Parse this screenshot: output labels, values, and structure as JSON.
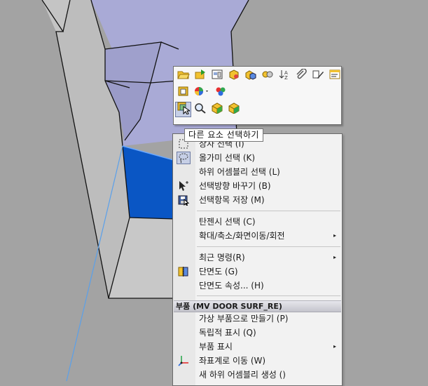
{
  "tooltip": "다른 요소 선택하기",
  "toolbar": {
    "row1": [
      "open-folder-icon",
      "rebuild-icon",
      "drawing-view-icon",
      "part-icon",
      "assembly-icon",
      "mate-icon",
      "sort-icon",
      "paperclip-icon",
      "edit-sketch-icon",
      "properties-icon"
    ],
    "row2": [
      "component-properties-icon",
      "appearance-icon",
      "color-wheel-icon"
    ],
    "row3": [
      "select-other-icon",
      "zoom-to-selection-icon",
      "hide-component-icon",
      "show-component-icon"
    ]
  },
  "menu": {
    "items_top": [
      {
        "label": "상자 선택 (I)",
        "icon": "box-select-icon",
        "active": false
      },
      {
        "label": "올가미 선택 (K)",
        "icon": "lasso-select-icon",
        "active": true
      },
      {
        "label": "하위 어셈블리 선택 (L)",
        "icon": null,
        "active": false
      },
      {
        "label": "선택방향 바꾸기 (B)",
        "icon": "cursor-arrow-icon",
        "active": false
      },
      {
        "label": "선택항목 저장 (M)",
        "icon": "save-selection-icon",
        "active": false
      }
    ],
    "items_mid": [
      {
        "label": "탄젠시 선택 (C)",
        "submenu": false
      },
      {
        "label": "확대/축소/화면이동/회전",
        "submenu": true
      }
    ],
    "items_cmd": [
      {
        "label": "최근 명령(R)",
        "submenu": true,
        "icon": null
      },
      {
        "label": "단면도 (G)",
        "submenu": false,
        "icon": "section-view-icon"
      },
      {
        "label": "단면도 속성... (H)",
        "submenu": false,
        "icon": null
      }
    ],
    "section_header": "부품 (MV DOOR SURF_RE)",
    "items_part": [
      {
        "label": "가상 부품으로 만들기 (P)",
        "submenu": false,
        "icon": null
      },
      {
        "label": "독립적 표시 (Q)",
        "submenu": false,
        "icon": null
      },
      {
        "label": "부품 표시",
        "submenu": true,
        "icon": null
      },
      {
        "label": "좌표계로 이동 (W)",
        "submenu": false,
        "icon": "coordinate-system-icon"
      },
      {
        "label": "새 하위 어셈블리 생성 ()",
        "submenu": false,
        "icon": null
      }
    ]
  },
  "colors": {
    "background": "#a3a3a3",
    "blue_face": "#0a56c4",
    "lavender_face": "#a6a7d3",
    "menu_bg": "#f2f2f2"
  }
}
